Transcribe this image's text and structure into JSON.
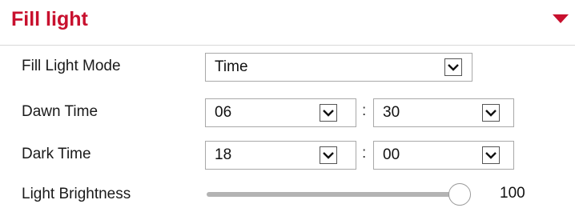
{
  "section": {
    "title": "Fill light",
    "collapse_icon": "caret-down-icon"
  },
  "fill_light_mode": {
    "label": "Fill Light Mode",
    "value": "Time"
  },
  "dawn_time": {
    "label": "Dawn Time",
    "hour": "06",
    "separator": ":",
    "minute": "30"
  },
  "dark_time": {
    "label": "Dark Time",
    "hour": "18",
    "separator": ":",
    "minute": "00"
  },
  "brightness": {
    "label": "Light Brightness",
    "value": "100",
    "fraction": 1.0
  },
  "colors": {
    "accent": "#c8102e",
    "track": "#b3b3b3",
    "border": "#a8a8a8"
  }
}
